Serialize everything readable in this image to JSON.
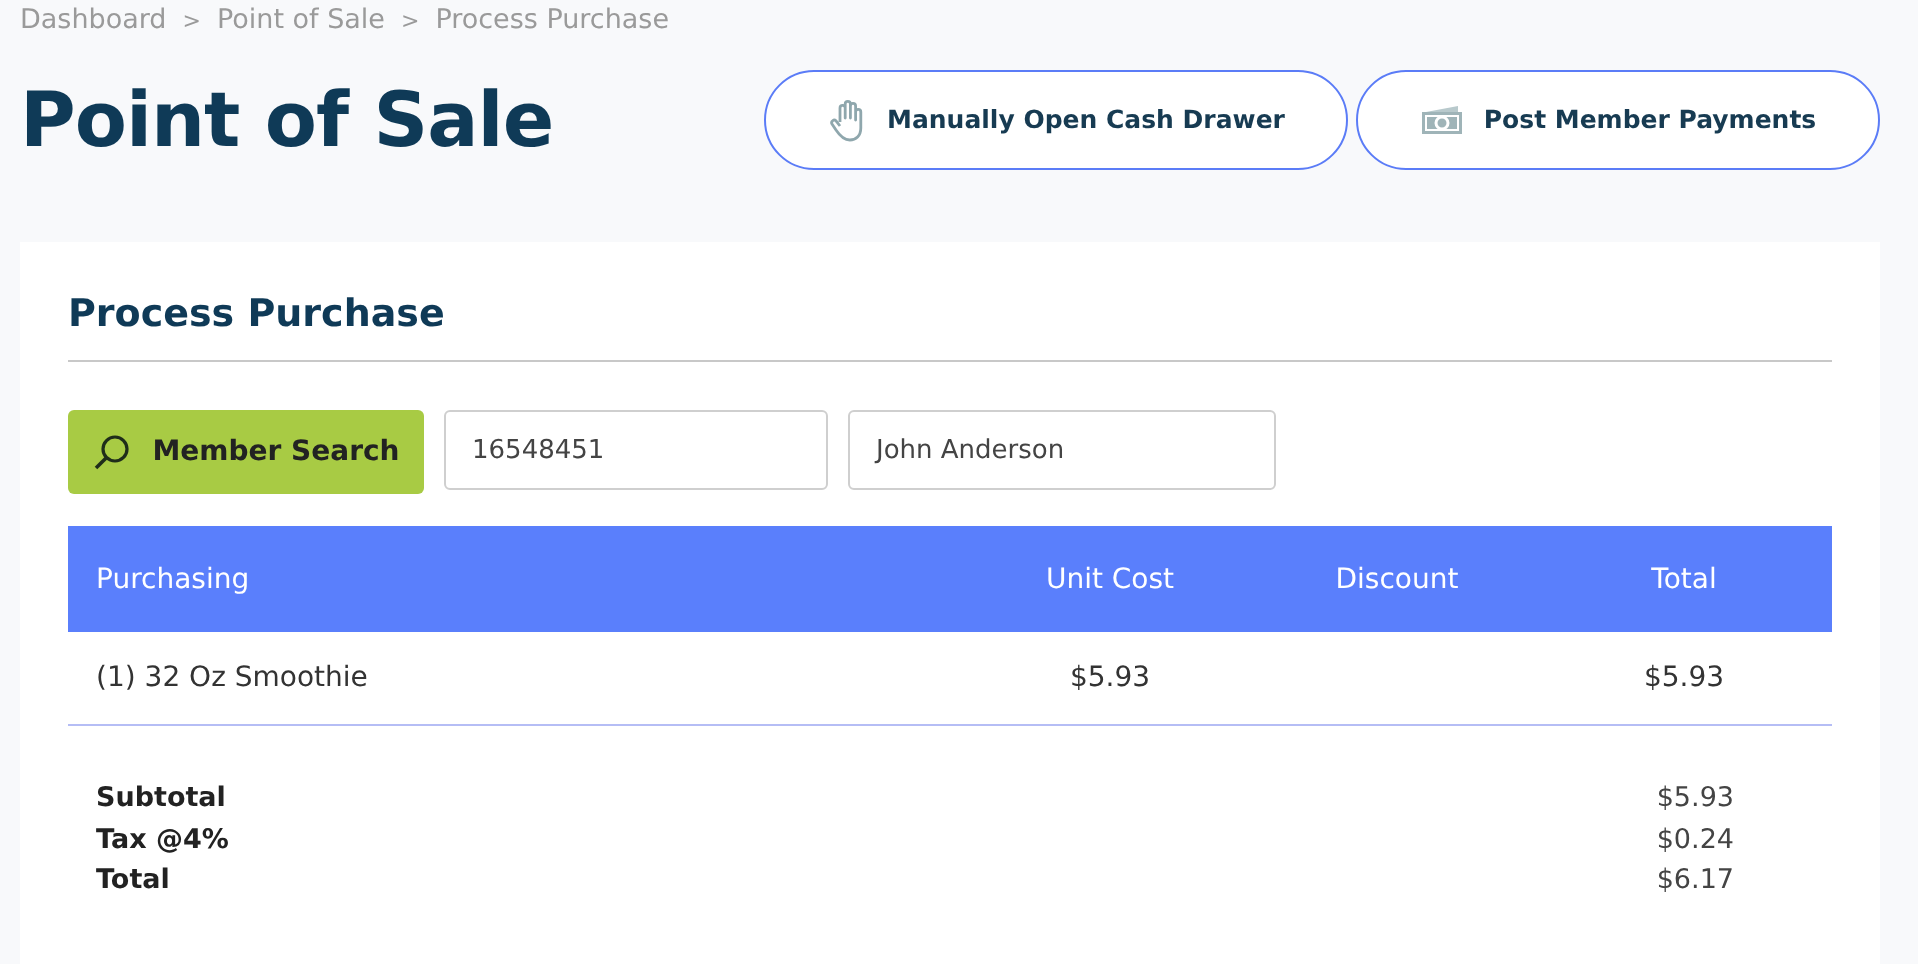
{
  "breadcrumb": [
    "Dashboard",
    "Point of Sale",
    "Process Purchase"
  ],
  "breadcrumb_separator": ">",
  "page_title": "Point of Sale",
  "header_buttons": [
    {
      "label": "Manually Open Cash Drawer",
      "kind": "hand"
    },
    {
      "label": "Post Member Payments",
      "kind": "cash"
    }
  ],
  "card": {
    "title": "Process Purchase",
    "member_search": {
      "button": "Member Search",
      "member_id": "16548451",
      "member_name": "John Anderson"
    },
    "table": {
      "columns": [
        "Purchasing",
        "Unit Cost",
        "Discount",
        "Total"
      ],
      "rows": [
        {
          "item": "(1) 32 Oz Smoothie",
          "unit_cost": "$5.93",
          "total": "$5.93"
        }
      ]
    },
    "summary": [
      {
        "label": "Subtotal",
        "value": "$5.93"
      },
      {
        "label": "Tax @4%",
        "value": "$0.24"
      },
      {
        "label": "Total",
        "value": "$6.17"
      }
    ]
  }
}
